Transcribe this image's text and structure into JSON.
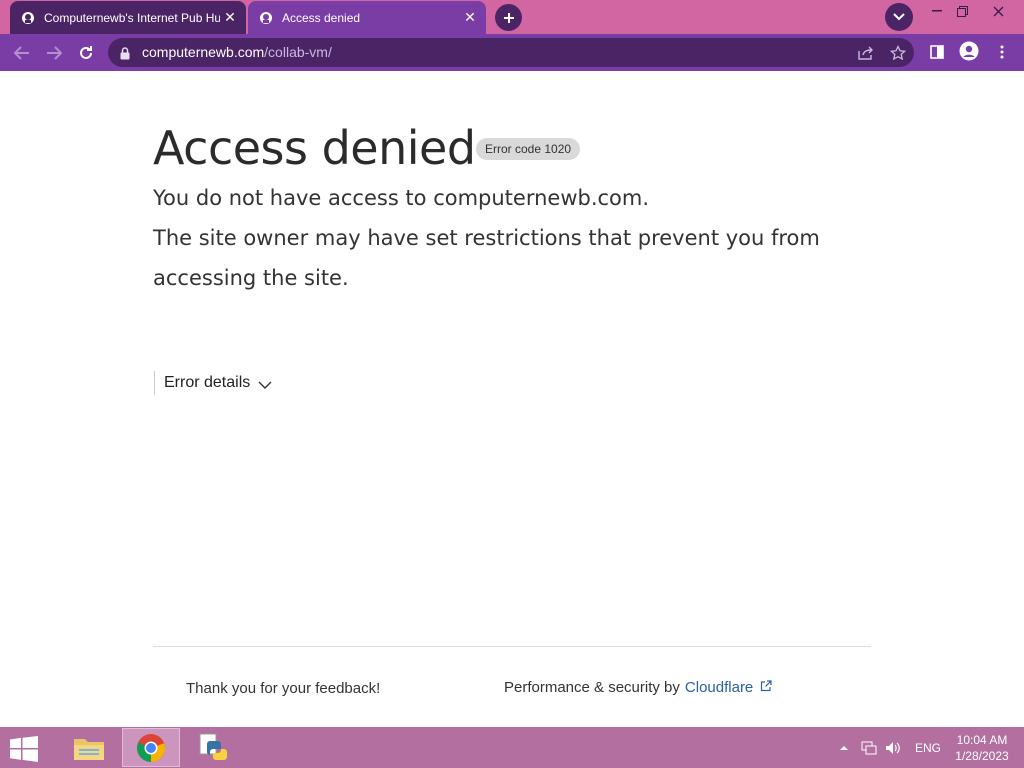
{
  "browser": {
    "tabs": [
      {
        "title": "Computernewb's Internet Pub Hu",
        "active": false
      },
      {
        "title": "Access denied",
        "active": true
      }
    ],
    "address": {
      "domain": "computernewb.com",
      "path": "/collab-vm/"
    },
    "colors": {
      "tab_strip": "#d166a3",
      "toolbar": "#7a3da6",
      "omnibox": "#4b2466"
    }
  },
  "page": {
    "title": "Access denied",
    "error_badge": "Error code 1020",
    "line1": "You do not have access to computernewb.com.",
    "line2": "The site owner may have set restrictions that prevent you from",
    "line3": "accessing the site.",
    "details_label": "Error details",
    "feedback": "Thank you for your feedback!",
    "perf_prefix": "Performance & security by",
    "perf_link": "Cloudflare"
  },
  "taskbar": {
    "language": "ENG",
    "time": "10:04 AM",
    "date": "1/28/2023",
    "apps": [
      "file-explorer",
      "chrome",
      "python"
    ]
  }
}
